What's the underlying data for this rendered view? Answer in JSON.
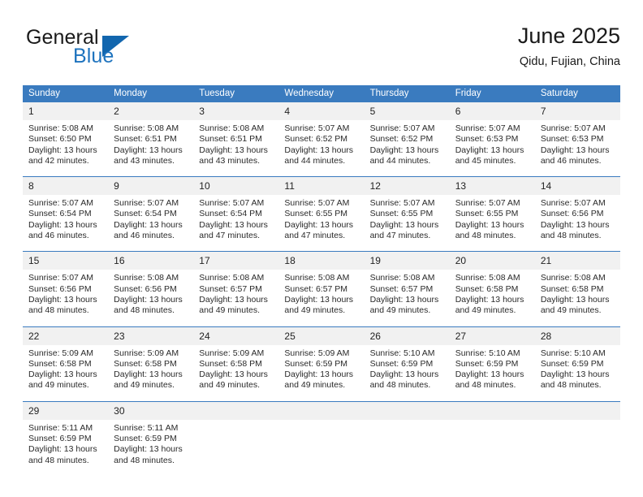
{
  "brand": {
    "word_one": "General",
    "word_two": "Blue",
    "triangle_icon": "triangle-logo-icon",
    "accent_color": "#1266ae",
    "text_color": "#1a1a1a"
  },
  "header": {
    "title": "June 2025",
    "subtitle": "Qidu, Fujian, China"
  },
  "theme": {
    "header_blue": "#3a7bbf",
    "daynum_band": "#f1f1f1",
    "body_text": "#2a2a2a"
  },
  "calendar": {
    "weekday_headers": [
      "Sunday",
      "Monday",
      "Tuesday",
      "Wednesday",
      "Thursday",
      "Friday",
      "Saturday"
    ],
    "weeks": [
      {
        "days": [
          {
            "num": "1",
            "sunrise": "Sunrise: 5:08 AM",
            "sunset": "Sunset: 6:50 PM",
            "daylight_line1": "Daylight: 13 hours",
            "daylight_line2": "and 42 minutes."
          },
          {
            "num": "2",
            "sunrise": "Sunrise: 5:08 AM",
            "sunset": "Sunset: 6:51 PM",
            "daylight_line1": "Daylight: 13 hours",
            "daylight_line2": "and 43 minutes."
          },
          {
            "num": "3",
            "sunrise": "Sunrise: 5:08 AM",
            "sunset": "Sunset: 6:51 PM",
            "daylight_line1": "Daylight: 13 hours",
            "daylight_line2": "and 43 minutes."
          },
          {
            "num": "4",
            "sunrise": "Sunrise: 5:07 AM",
            "sunset": "Sunset: 6:52 PM",
            "daylight_line1": "Daylight: 13 hours",
            "daylight_line2": "and 44 minutes."
          },
          {
            "num": "5",
            "sunrise": "Sunrise: 5:07 AM",
            "sunset": "Sunset: 6:52 PM",
            "daylight_line1": "Daylight: 13 hours",
            "daylight_line2": "and 44 minutes."
          },
          {
            "num": "6",
            "sunrise": "Sunrise: 5:07 AM",
            "sunset": "Sunset: 6:53 PM",
            "daylight_line1": "Daylight: 13 hours",
            "daylight_line2": "and 45 minutes."
          },
          {
            "num": "7",
            "sunrise": "Sunrise: 5:07 AM",
            "sunset": "Sunset: 6:53 PM",
            "daylight_line1": "Daylight: 13 hours",
            "daylight_line2": "and 46 minutes."
          }
        ]
      },
      {
        "days": [
          {
            "num": "8",
            "sunrise": "Sunrise: 5:07 AM",
            "sunset": "Sunset: 6:54 PM",
            "daylight_line1": "Daylight: 13 hours",
            "daylight_line2": "and 46 minutes."
          },
          {
            "num": "9",
            "sunrise": "Sunrise: 5:07 AM",
            "sunset": "Sunset: 6:54 PM",
            "daylight_line1": "Daylight: 13 hours",
            "daylight_line2": "and 46 minutes."
          },
          {
            "num": "10",
            "sunrise": "Sunrise: 5:07 AM",
            "sunset": "Sunset: 6:54 PM",
            "daylight_line1": "Daylight: 13 hours",
            "daylight_line2": "and 47 minutes."
          },
          {
            "num": "11",
            "sunrise": "Sunrise: 5:07 AM",
            "sunset": "Sunset: 6:55 PM",
            "daylight_line1": "Daylight: 13 hours",
            "daylight_line2": "and 47 minutes."
          },
          {
            "num": "12",
            "sunrise": "Sunrise: 5:07 AM",
            "sunset": "Sunset: 6:55 PM",
            "daylight_line1": "Daylight: 13 hours",
            "daylight_line2": "and 47 minutes."
          },
          {
            "num": "13",
            "sunrise": "Sunrise: 5:07 AM",
            "sunset": "Sunset: 6:55 PM",
            "daylight_line1": "Daylight: 13 hours",
            "daylight_line2": "and 48 minutes."
          },
          {
            "num": "14",
            "sunrise": "Sunrise: 5:07 AM",
            "sunset": "Sunset: 6:56 PM",
            "daylight_line1": "Daylight: 13 hours",
            "daylight_line2": "and 48 minutes."
          }
        ]
      },
      {
        "days": [
          {
            "num": "15",
            "sunrise": "Sunrise: 5:07 AM",
            "sunset": "Sunset: 6:56 PM",
            "daylight_line1": "Daylight: 13 hours",
            "daylight_line2": "and 48 minutes."
          },
          {
            "num": "16",
            "sunrise": "Sunrise: 5:08 AM",
            "sunset": "Sunset: 6:56 PM",
            "daylight_line1": "Daylight: 13 hours",
            "daylight_line2": "and 48 minutes."
          },
          {
            "num": "17",
            "sunrise": "Sunrise: 5:08 AM",
            "sunset": "Sunset: 6:57 PM",
            "daylight_line1": "Daylight: 13 hours",
            "daylight_line2": "and 49 minutes."
          },
          {
            "num": "18",
            "sunrise": "Sunrise: 5:08 AM",
            "sunset": "Sunset: 6:57 PM",
            "daylight_line1": "Daylight: 13 hours",
            "daylight_line2": "and 49 minutes."
          },
          {
            "num": "19",
            "sunrise": "Sunrise: 5:08 AM",
            "sunset": "Sunset: 6:57 PM",
            "daylight_line1": "Daylight: 13 hours",
            "daylight_line2": "and 49 minutes."
          },
          {
            "num": "20",
            "sunrise": "Sunrise: 5:08 AM",
            "sunset": "Sunset: 6:58 PM",
            "daylight_line1": "Daylight: 13 hours",
            "daylight_line2": "and 49 minutes."
          },
          {
            "num": "21",
            "sunrise": "Sunrise: 5:08 AM",
            "sunset": "Sunset: 6:58 PM",
            "daylight_line1": "Daylight: 13 hours",
            "daylight_line2": "and 49 minutes."
          }
        ]
      },
      {
        "days": [
          {
            "num": "22",
            "sunrise": "Sunrise: 5:09 AM",
            "sunset": "Sunset: 6:58 PM",
            "daylight_line1": "Daylight: 13 hours",
            "daylight_line2": "and 49 minutes."
          },
          {
            "num": "23",
            "sunrise": "Sunrise: 5:09 AM",
            "sunset": "Sunset: 6:58 PM",
            "daylight_line1": "Daylight: 13 hours",
            "daylight_line2": "and 49 minutes."
          },
          {
            "num": "24",
            "sunrise": "Sunrise: 5:09 AM",
            "sunset": "Sunset: 6:58 PM",
            "daylight_line1": "Daylight: 13 hours",
            "daylight_line2": "and 49 minutes."
          },
          {
            "num": "25",
            "sunrise": "Sunrise: 5:09 AM",
            "sunset": "Sunset: 6:59 PM",
            "daylight_line1": "Daylight: 13 hours",
            "daylight_line2": "and 49 minutes."
          },
          {
            "num": "26",
            "sunrise": "Sunrise: 5:10 AM",
            "sunset": "Sunset: 6:59 PM",
            "daylight_line1": "Daylight: 13 hours",
            "daylight_line2": "and 48 minutes."
          },
          {
            "num": "27",
            "sunrise": "Sunrise: 5:10 AM",
            "sunset": "Sunset: 6:59 PM",
            "daylight_line1": "Daylight: 13 hours",
            "daylight_line2": "and 48 minutes."
          },
          {
            "num": "28",
            "sunrise": "Sunrise: 5:10 AM",
            "sunset": "Sunset: 6:59 PM",
            "daylight_line1": "Daylight: 13 hours",
            "daylight_line2": "and 48 minutes."
          }
        ]
      },
      {
        "days": [
          {
            "num": "29",
            "sunrise": "Sunrise: 5:11 AM",
            "sunset": "Sunset: 6:59 PM",
            "daylight_line1": "Daylight: 13 hours",
            "daylight_line2": "and 48 minutes."
          },
          {
            "num": "30",
            "sunrise": "Sunrise: 5:11 AM",
            "sunset": "Sunset: 6:59 PM",
            "daylight_line1": "Daylight: 13 hours",
            "daylight_line2": "and 48 minutes."
          },
          {
            "num": "",
            "sunrise": "",
            "sunset": "",
            "daylight_line1": "",
            "daylight_line2": ""
          },
          {
            "num": "",
            "sunrise": "",
            "sunset": "",
            "daylight_line1": "",
            "daylight_line2": ""
          },
          {
            "num": "",
            "sunrise": "",
            "sunset": "",
            "daylight_line1": "",
            "daylight_line2": ""
          },
          {
            "num": "",
            "sunrise": "",
            "sunset": "",
            "daylight_line1": "",
            "daylight_line2": ""
          },
          {
            "num": "",
            "sunrise": "",
            "sunset": "",
            "daylight_line1": "",
            "daylight_line2": ""
          }
        ]
      }
    ]
  }
}
